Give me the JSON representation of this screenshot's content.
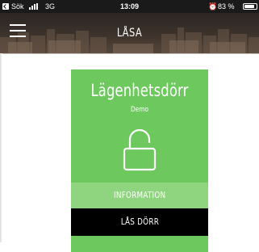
{
  "status_bar": {
    "back_label": "Sök",
    "network": "3G",
    "time": "13:09",
    "battery_text": "83 %",
    "battery_level": 0.83
  },
  "nav": {
    "title": "LÅSA"
  },
  "lock_card": {
    "name": "Lägenhetsdörr",
    "subtitle": "Demo",
    "info_label": "INFORMATION",
    "lock_button_label": "LÅS DÖRR",
    "colors": {
      "card": "#6dc85e",
      "info_row": "#8fd47f",
      "button": "#000000"
    }
  },
  "icons": {
    "back": "back-arrow-icon",
    "signal": "signal-strength-icon",
    "alarm": "alarm-clock-icon",
    "battery": "battery-icon",
    "menu": "hamburger-menu-icon",
    "padlock": "unlocked-padlock-icon"
  }
}
